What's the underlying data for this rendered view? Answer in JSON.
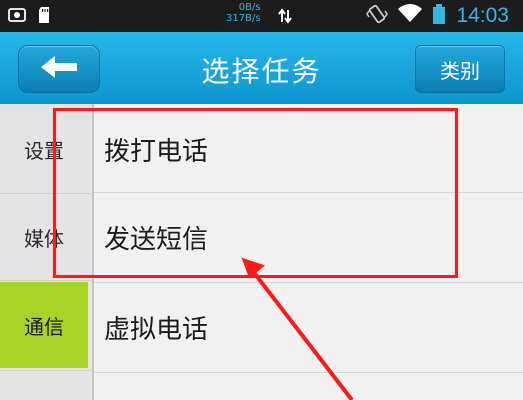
{
  "statusbar": {
    "speed_up": "0B/s",
    "speed_down": "317B/s",
    "time": "14:03",
    "icons": [
      "photo-icon",
      "sd-card-icon",
      "data-arrows-icon",
      "vibrate-icon",
      "wifi-icon",
      "battery-icon"
    ]
  },
  "header": {
    "title": "选择任务",
    "category_label": "类别",
    "back_icon": "arrow-left-icon"
  },
  "sidebar": {
    "items": [
      {
        "label": "设置",
        "active": false
      },
      {
        "label": "媒体",
        "active": false
      },
      {
        "label": "通信",
        "active": true
      }
    ]
  },
  "tasks": [
    {
      "label": "拨打电话"
    },
    {
      "label": "发送短信"
    },
    {
      "label": "虚拟电话"
    }
  ],
  "colors": {
    "header": "#1aa6dc",
    "active_tab": "#a8d42a",
    "annotation": "#ff1a1a",
    "accent_text": "#33b5e5"
  }
}
